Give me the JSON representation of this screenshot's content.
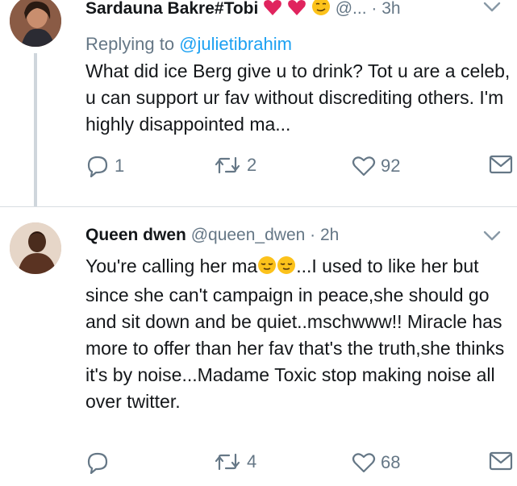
{
  "tweet1": {
    "author_name": "Sardauna Bakre#Tobi",
    "handle": "@...",
    "separator": "·",
    "time": "3h",
    "replying_prefix": "Replying to",
    "replying_mention": "@julietibrahim",
    "text": "What did ice Berg give u to drink? Tot u are a celeb, u can support ur fav without discrediting others. I'm highly disappointed ma...",
    "reply_count": "1",
    "retweet_count": "2",
    "like_count": "92"
  },
  "tweet2": {
    "author_name": "Queen dwen",
    "handle": "@queen_dwen",
    "separator": "·",
    "time": "2h",
    "text_before_emoji": "You're calling her ma",
    "text_after_emoji": "...I used to like her but since she can't campaign in peace,she should go and sit down and be quiet..mschwww!! Miracle has more to offer than her fav that's the truth,she thinks it's by noise...Madame Toxic stop making noise all over twitter.",
    "reply_count": "",
    "retweet_count": "4",
    "like_count": "68"
  },
  "icons": {
    "caret": "chevron-down-icon",
    "reply": "reply-icon",
    "retweet": "retweet-icon",
    "like": "heart-icon",
    "dm": "envelope-icon"
  },
  "colors": {
    "link": "#1da1f2",
    "secondary_text": "#657786",
    "heart_emoji": "#e0245e",
    "emoji_face": "#fcc21b"
  }
}
